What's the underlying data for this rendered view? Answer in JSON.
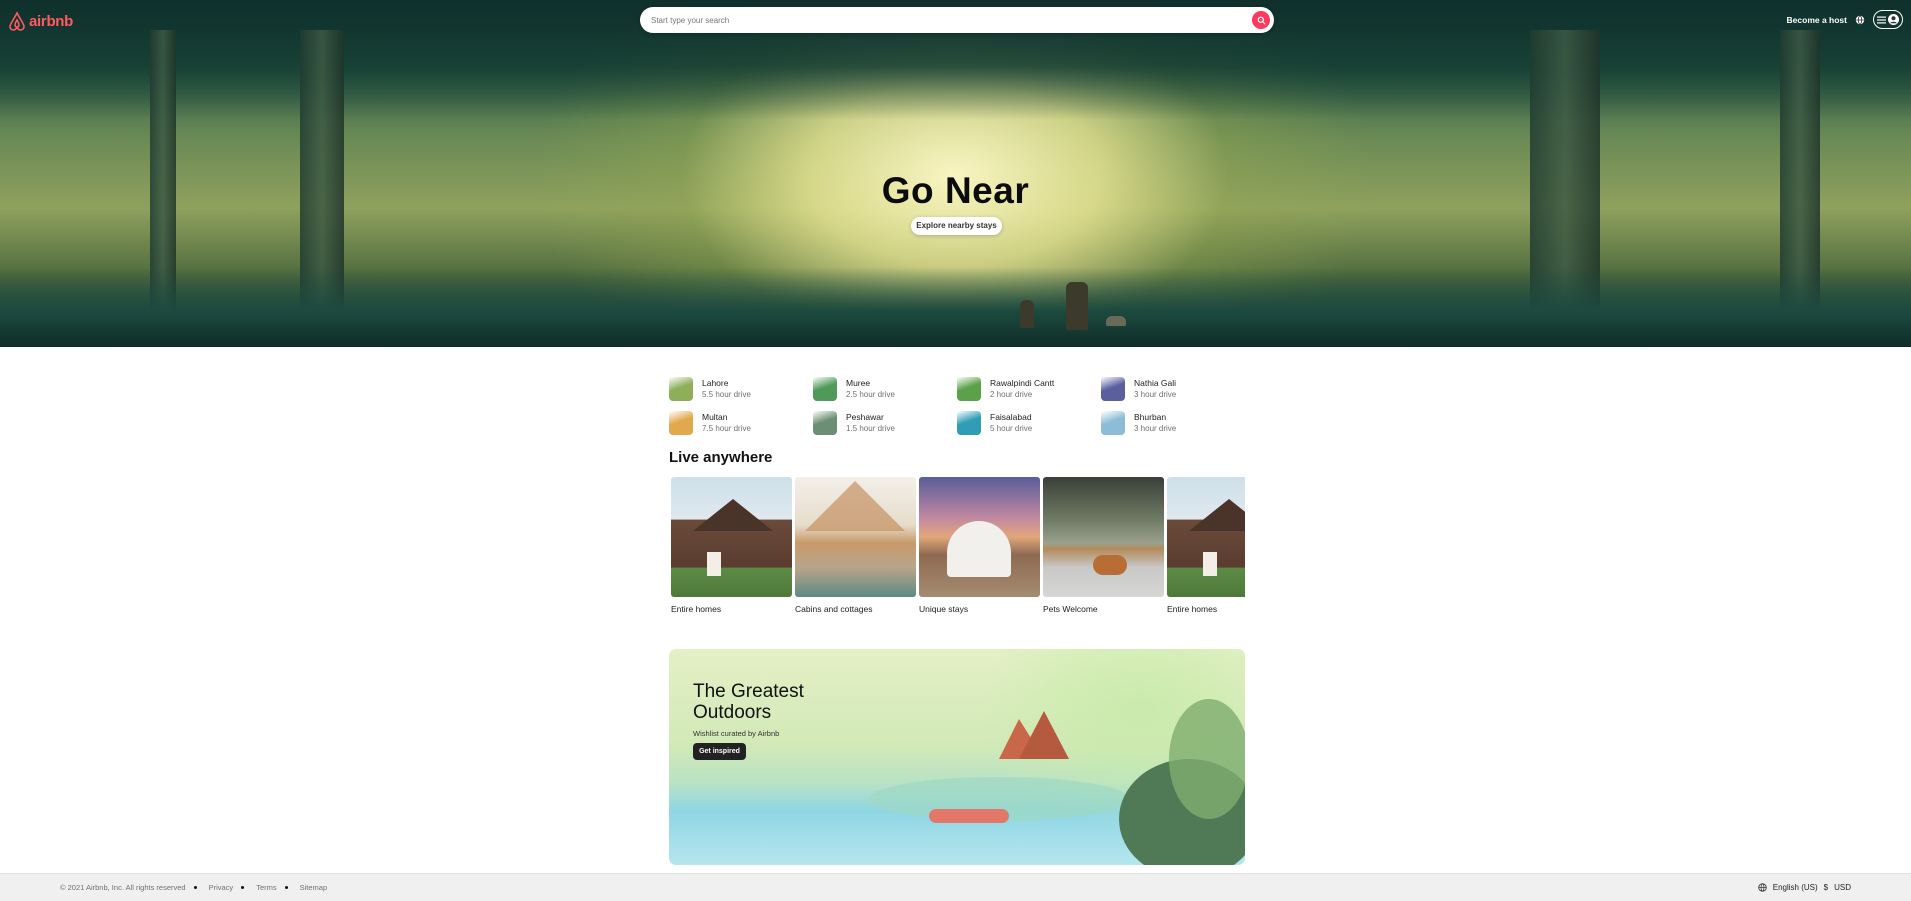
{
  "header": {
    "brand": "airbnb",
    "search_placeholder": "Start type your search",
    "become_host": "Become a host"
  },
  "hero": {
    "title": "Go Near",
    "button": "Explore nearby stays"
  },
  "nearby": [
    {
      "name": "Lahore",
      "drive": "5.5 hour drive",
      "color": "#8fae5a"
    },
    {
      "name": "Muree",
      "drive": "2.5 hour drive",
      "color": "#4f9a58"
    },
    {
      "name": "Rawalpindi Cantt",
      "drive": "2 hour drive",
      "color": "#5aa14a"
    },
    {
      "name": "Nathia Gali",
      "drive": "3 hour drive",
      "color": "#5b5f9d"
    },
    {
      "name": "Multan",
      "drive": "7.5 hour drive",
      "color": "#e2a84c"
    },
    {
      "name": "Peshawar",
      "drive": "1.5 hour drive",
      "color": "#6c8f74"
    },
    {
      "name": "Faisalabad",
      "drive": "5 hour drive",
      "color": "#2f9db5"
    },
    {
      "name": "Bhurban",
      "drive": "3 hour drive",
      "color": "#8cbcd6"
    }
  ],
  "live_anywhere": {
    "title": "Live anywhere",
    "cards": [
      {
        "label": "Entire homes"
      },
      {
        "label": "Cabins and cottages"
      },
      {
        "label": "Unique stays"
      },
      {
        "label": "Pets Welcome"
      },
      {
        "label": "Entire homes"
      }
    ]
  },
  "banner": {
    "title": "The Greatest Outdoors",
    "subtitle": "Wishlist curated by Airbnb",
    "button": "Get inspired"
  },
  "footer": {
    "copyright": "© 2021 Airbnb, Inc. All rights reserved",
    "links": [
      "Privacy",
      "Terms",
      "Sitemap"
    ],
    "language": "English (US)",
    "currency_symbol": "$",
    "currency": "USD"
  },
  "colors": {
    "brand": "#ff5a5f",
    "search_button": "#ff385c"
  }
}
